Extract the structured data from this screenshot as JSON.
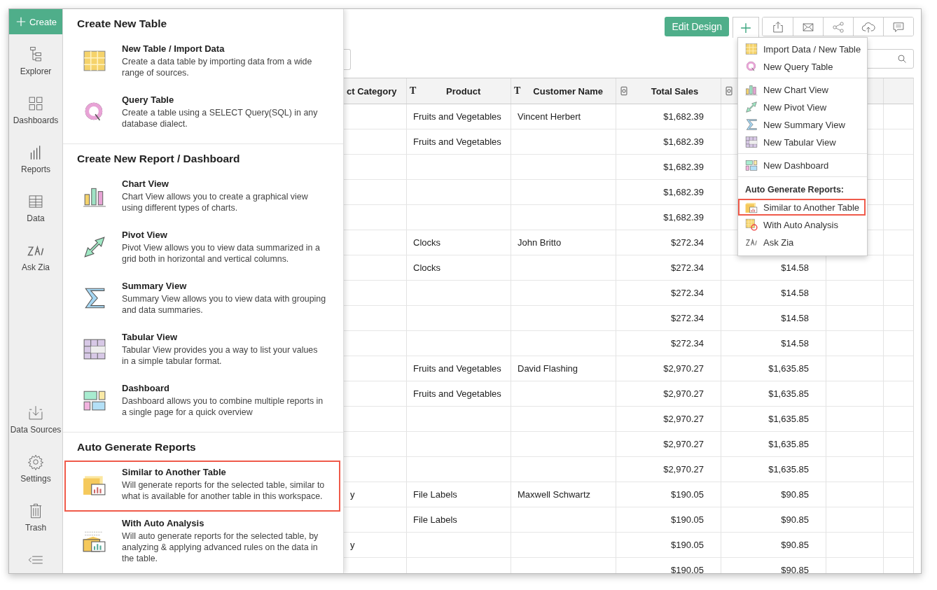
{
  "sidebar": {
    "create_button": "Create",
    "items": [
      {
        "label": "Explorer"
      },
      {
        "label": "Dashboards"
      },
      {
        "label": "Reports"
      },
      {
        "label": "Data"
      },
      {
        "label": "Ask Zia"
      }
    ],
    "bottom_items": [
      {
        "label": "Data Sources"
      },
      {
        "label": "Settings"
      },
      {
        "label": "Trash"
      }
    ]
  },
  "create_menu": {
    "sections": [
      {
        "title": "Create New Table",
        "items": [
          {
            "title": "New Table / Import Data",
            "description": "Create a data table by importing data from a wide range of sources.",
            "selected": false
          },
          {
            "title": "Query Table",
            "description": "Create a table using a SELECT Query(SQL) in any database dialect.",
            "selected": false
          }
        ]
      },
      {
        "title": "Create New Report / Dashboard",
        "items": [
          {
            "title": "Chart View",
            "description": "Chart View allows you to create a graphical view using different types of charts.",
            "selected": false
          },
          {
            "title": "Pivot View",
            "description": "Pivot View allows you to view data summarized in a grid both in horizontal and vertical columns.",
            "selected": false
          },
          {
            "title": "Summary View",
            "description": "Summary View allows you to view data with grouping and data summaries.",
            "selected": false
          },
          {
            "title": "Tabular View",
            "description": "Tabular View provides you a way to list your values in a simple tabular format.",
            "selected": false
          },
          {
            "title": "Dashboard",
            "description": "Dashboard allows you to combine multiple reports in a single page for a quick overview",
            "selected": false
          }
        ]
      },
      {
        "title": "Auto Generate Reports",
        "items": [
          {
            "title": "Similar to Another Table",
            "description": "Will generate reports for the selected table, similar to what is available for another table in this workspace.",
            "selected": true
          },
          {
            "title": "With Auto Analysis",
            "description": "Will auto generate reports for the selected table, by analyzing & applying advanced rules on the data in the table.",
            "selected": false
          }
        ]
      }
    ]
  },
  "toolbar": {
    "edit_button": "Edit Design"
  },
  "add_menu": {
    "groups": [
      {
        "items": [
          {
            "label": "Import Data / New Table",
            "selected": false
          },
          {
            "label": "New Query Table",
            "selected": false
          }
        ]
      },
      {
        "items": [
          {
            "label": "New Chart View",
            "selected": false
          },
          {
            "label": "New Pivot View",
            "selected": false
          },
          {
            "label": "New Summary View",
            "selected": false
          },
          {
            "label": "New Tabular View",
            "selected": false
          }
        ]
      },
      {
        "items": [
          {
            "label": "New Dashboard",
            "selected": false
          }
        ]
      },
      {
        "heading": "Auto Generate Reports:",
        "items": [
          {
            "label": "Similar to Another Table",
            "selected": true
          },
          {
            "label": "With Auto Analysis",
            "selected": false
          },
          {
            "label": "Ask Zia",
            "selected": false
          }
        ]
      }
    ]
  },
  "table": {
    "columns": [
      {
        "label": "ct Category"
      },
      {
        "label": "Product",
        "type_mark": "T"
      },
      {
        "label": "Customer Name",
        "type_mark": "T"
      },
      {
        "label": "Total Sales",
        "kind": "currency"
      },
      {
        "kind": "currency"
      }
    ],
    "rows": [
      {
        "product": "Fruits and Vegetables",
        "customer": "Vincent Herbert",
        "total_sales": "$1,682.39"
      },
      {
        "product": "Fruits and Vegetables",
        "total_sales": "$1,682.39"
      },
      {
        "total_sales": "$1,682.39"
      },
      {
        "total_sales": "$1,682.39"
      },
      {
        "total_sales": "$1,682.39"
      },
      {
        "product": "Clocks",
        "customer": "John Britto",
        "total_sales": "$272.34"
      },
      {
        "product": "Clocks",
        "total_sales": "$272.34",
        "column_5": "$14.58"
      },
      {
        "total_sales": "$272.34",
        "column_5": "$14.58"
      },
      {
        "total_sales": "$272.34",
        "column_5": "$14.58"
      },
      {
        "total_sales": "$272.34",
        "column_5": "$14.58"
      },
      {
        "product": "Fruits and Vegetables",
        "customer": "David Flashing",
        "total_sales": "$2,970.27",
        "column_5": "$1,635.85"
      },
      {
        "product": "Fruits and Vegetables",
        "total_sales": "$2,970.27",
        "column_5": "$1,635.85"
      },
      {
        "total_sales": "$2,970.27",
        "column_5": "$1,635.85"
      },
      {
        "total_sales": "$2,970.27",
        "column_5": "$1,635.85"
      },
      {
        "total_sales": "$2,970.27",
        "column_5": "$1,635.85"
      },
      {
        "category": "y",
        "product": "File Labels",
        "customer": "Maxwell Schwartz",
        "total_sales": "$190.05",
        "column_5": "$90.85"
      },
      {
        "product": "File Labels",
        "total_sales": "$190.05",
        "column_5": "$90.85"
      },
      {
        "category": "y",
        "total_sales": "$190.05",
        "column_5": "$90.85"
      },
      {
        "total_sales": "$190.05",
        "column_5": "$90.85"
      }
    ]
  }
}
